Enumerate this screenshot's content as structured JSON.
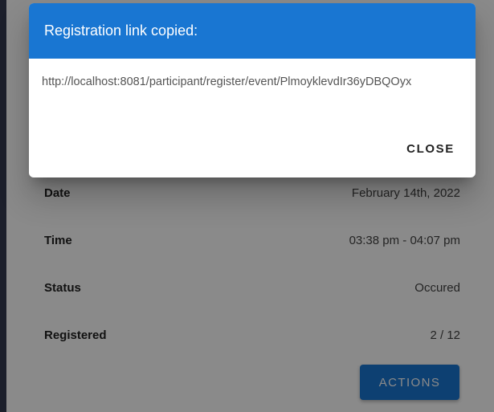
{
  "details": [
    {
      "label": "Date",
      "value": "February 14th, 2022"
    },
    {
      "label": "Time",
      "value": "03:38 pm - 04:07 pm"
    },
    {
      "label": "Status",
      "value": "Occured"
    },
    {
      "label": "Registered",
      "value": "2 / 12"
    }
  ],
  "actions_label": "ACTIONS",
  "dialog": {
    "title": "Registration link copied:",
    "link": "http://localhost:8081/participant/register/event/PlmoyklevdIr36yDBQOyx",
    "close_label": "CLOSE"
  },
  "colors": {
    "primary": "#1976d2",
    "backdrop": "#3b4157"
  }
}
